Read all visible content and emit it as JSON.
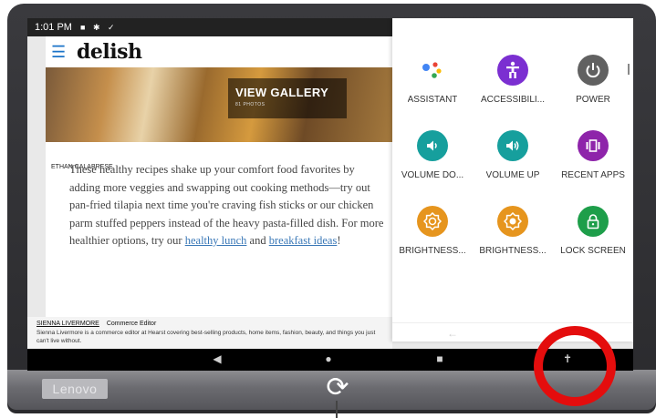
{
  "status_bar": {
    "time": "1:01 PM"
  },
  "article": {
    "logo": "delish",
    "gallery_title": "VIEW GALLERY",
    "gallery_sub": "81 PHOTOS",
    "photo_credit": "ETHAN CALABRESE",
    "body_start": "These healthy recipes shake up your comfort food favorites by adding more veggies and swapping out cooking methods—try out pan-fried tilapia next time you're craving fish sticks or our chicken parm stuffed peppers instead of the heavy pasta-filled dish. For more healthier options, try our ",
    "link_1": "healthy lunch",
    "body_mid": " and ",
    "link_2": "breakfast ideas",
    "body_end": "!",
    "author_name": "SIENNA LIVERMORE",
    "author_role": "Commerce Editor",
    "author_bio": "Sienna Livermore is a commerce editor at Hearst covering best-selling products, home items, fashion, beauty, and things you just can't live without."
  },
  "accessibility_menu": {
    "items": [
      {
        "label": "ASSISTANT",
        "icon": "assistant-icon",
        "color": "#ffffff"
      },
      {
        "label": "ACCESSIBILI...",
        "icon": "accessibility-icon",
        "color": "#7b2fd1"
      },
      {
        "label": "POWER",
        "icon": "power-icon",
        "color": "#616161"
      },
      {
        "label": "VOLUME DO...",
        "icon": "volume-down-icon",
        "color": "#169f9d"
      },
      {
        "label": "VOLUME UP",
        "icon": "volume-up-icon",
        "color": "#169f9d"
      },
      {
        "label": "RECENT APPS",
        "icon": "recent-apps-icon",
        "color": "#8e24aa"
      },
      {
        "label": "BRIGHTNESS...",
        "icon": "brightness-down-icon",
        "color": "#e6951e"
      },
      {
        "label": "BRIGHTNESS...",
        "icon": "brightness-up-icon",
        "color": "#e6951e"
      },
      {
        "label": "LOCK SCREEN",
        "icon": "lock-icon",
        "color": "#1e9e4a"
      }
    ]
  },
  "device": {
    "brand": "Lenovo"
  }
}
